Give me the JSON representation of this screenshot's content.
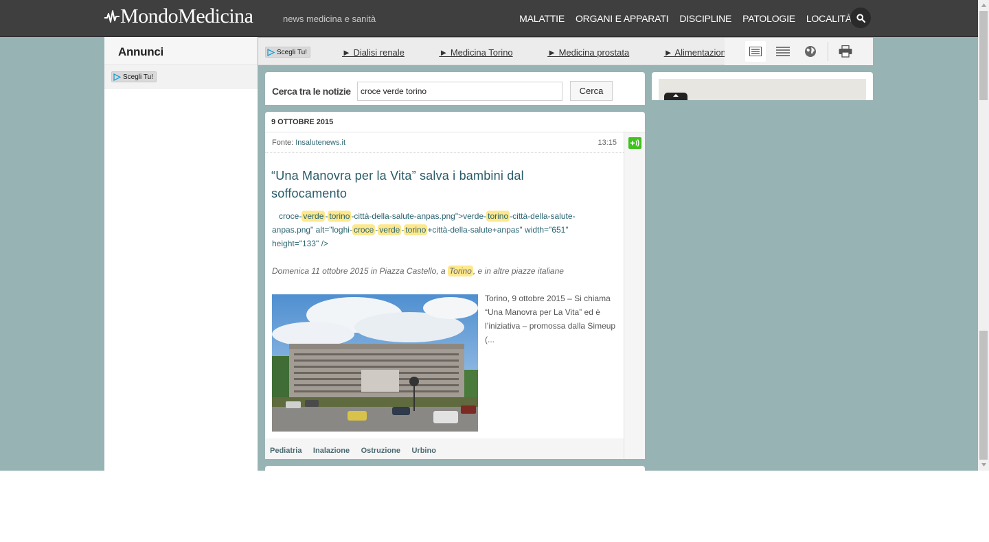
{
  "header": {
    "logo": "MondoMedicina",
    "tagline": "news medicina e sanità",
    "nav": [
      "MALATTIE",
      "ORGANI E APPARATI",
      "DISCIPLINE",
      "PATOLOGIE",
      "LOCALITÀ"
    ],
    "search_icon": "magnifier-icon"
  },
  "sidebar": {
    "title": "Annunci",
    "adchoice": "Scegli Tu!"
  },
  "strip": {
    "adchoice": "Scegli Tu!",
    "links": [
      "► Dialisi renale",
      "► Medicina Torino",
      "► Medicina prostata",
      "► Alimentazione"
    ],
    "tools": [
      "list-view-icon",
      "compact-list-icon",
      "globe-icon",
      "print-icon"
    ]
  },
  "search": {
    "label": "Cerca tra le notizie",
    "value": "croce verde torino",
    "button": "Cerca"
  },
  "article": {
    "date": "9 OTTOBRE 2015",
    "source_label": "Fonte:",
    "source": "Insalutenews.it",
    "time": "13:15",
    "share_icon": "share-plus-icon",
    "title": "“Una Manovra per la Vita” salva i bambini dal soffocamento",
    "code": {
      "p1": "croce-",
      "h1": "verde",
      "p2": "-",
      "h2": "torino",
      "p3": "-città-della-salute-anpas.png\">verde-",
      "h3": "torino",
      "p4": "-città-della-salute-anpas.png\" alt=\"loghi-",
      "h4": "croce",
      "p5": "-",
      "h5": "verde",
      "p6": "-",
      "h6": "torino",
      "p7": "+città-della-salute+anpas\" width=\"651\" height=\"133\" />"
    },
    "lead": {
      "before": "Domenica 11 ottobre 2015 in Piazza Castello, a",
      "highlight": "Torino",
      "after": ", e in altre piazze italiane"
    },
    "excerpt": "Torino, 9 ottobre 2015 – Si chiama “Una Manovra per La Vita” ed è l’iniziativa – promossa dalla Simeup (...",
    "tags": [
      "Pediatria",
      "Inalazione",
      "Ostruzione",
      "Urbino"
    ]
  },
  "colors": {
    "header_bg": "#3f3f3f",
    "page_bg": "#97b3b4",
    "title_color": "#285a67",
    "highlight": "#fde88c",
    "share_green": "#3ec21e"
  }
}
